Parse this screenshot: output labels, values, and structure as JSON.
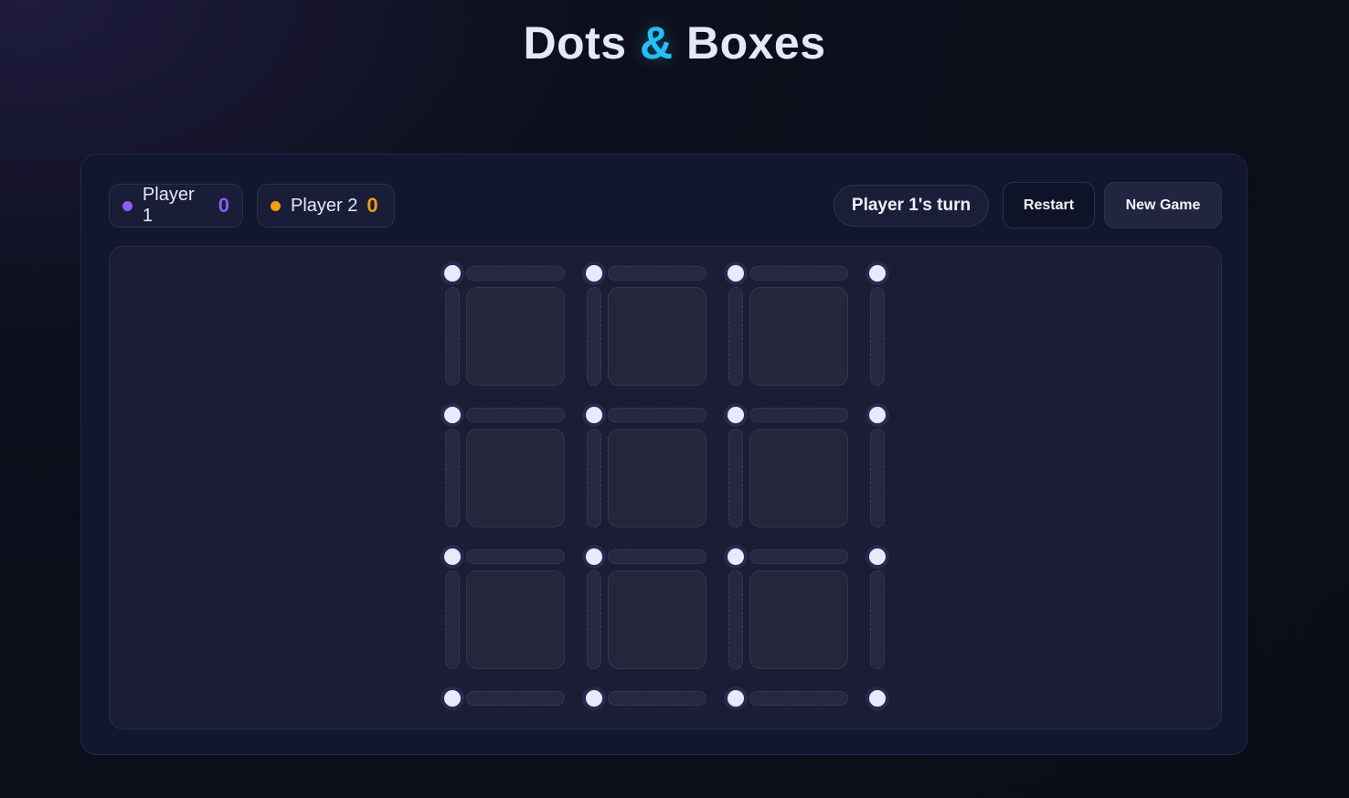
{
  "app": {
    "title_left": "Dots",
    "title_amp": "&",
    "title_right": "Boxes"
  },
  "players": [
    {
      "name": "Player 1",
      "score": "0",
      "color": "#8b5cf6"
    },
    {
      "name": "Player 2",
      "score": "0",
      "color": "#f59e0b"
    }
  ],
  "status": {
    "turn_text": "Player 1's turn"
  },
  "buttons": {
    "restart": "Restart",
    "new_game": "New Game"
  },
  "board": {
    "rows": 3,
    "cols": 3,
    "claimed_lines": [],
    "claimed_boxes": []
  },
  "colors": {
    "accent": "#22c1f5",
    "background": "#0b0d17",
    "panel": "#111631"
  }
}
